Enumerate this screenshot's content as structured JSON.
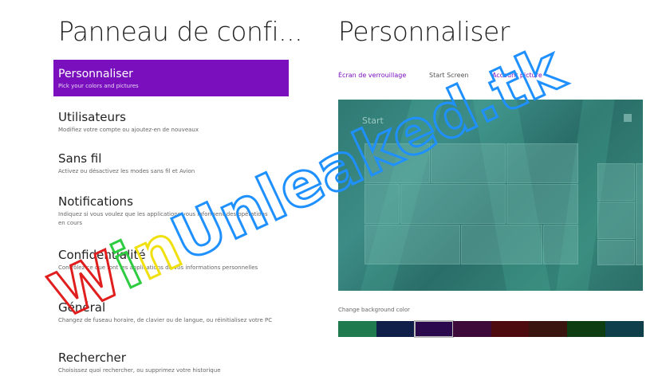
{
  "left_panel": {
    "title": "Panneau de confi...",
    "items": [
      {
        "label": "Personnaliser",
        "desc": "Pick your colors and pictures",
        "selected": true
      },
      {
        "label": "Utilisateurs",
        "desc": "Modifiez votre compte ou ajoutez-en de nouveaux"
      },
      {
        "label": "Sans fil",
        "desc": "Activez ou désactivez les modes sans fil et Avion"
      },
      {
        "label": "Notifications",
        "desc": "Indiquez si vous voulez que les applications vous informent des opérations en cours"
      },
      {
        "label": "Confidentialité",
        "desc": "Contrôlez ce que font les applications de vos informations personnelles"
      },
      {
        "label": "Général",
        "desc": "Changez de fuseau horaire, de clavier ou de langue, ou réinitialisez votre PC"
      },
      {
        "label": "Rechercher",
        "desc": "Choisissez quoi rechercher, ou supprimez votre historique"
      }
    ]
  },
  "right_panel": {
    "title": "Personnaliser",
    "tabs": [
      {
        "label": "Écran de verrouillage",
        "active": true
      },
      {
        "label": "Start Screen",
        "active": false
      },
      {
        "label": "Account picture",
        "active": true
      }
    ],
    "preview": {
      "start_label": "Start"
    },
    "background_color_label": "Change background color",
    "swatches": [
      "#1f7a4e",
      "#0f1f4a",
      "#2a0a4d",
      "#3d0a3a",
      "#4d0a0f",
      "#3a150f",
      "#0f3d12",
      "#0f3f4a"
    ],
    "selected_swatch_index": 2
  },
  "watermark": {
    "text": "WinUnleaked.tk",
    "colors": [
      "#e01e1e",
      "#2ecc40",
      "#f0e010",
      "#1e90ff",
      "#1e90ff",
      "#1e90ff",
      "#1e90ff",
      "#1e90ff",
      "#1e90ff",
      "#1e90ff",
      "#1e90ff",
      "#1e90ff",
      "#1e90ff",
      "#1e90ff"
    ]
  }
}
